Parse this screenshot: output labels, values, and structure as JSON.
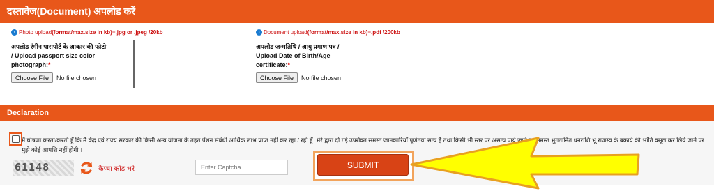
{
  "documents_section": {
    "title": "दस्तावेज(Document) अपलोड करें",
    "photo": {
      "hint_prefix": "Photo upload ",
      "hint_bold": "(format/max.size in kb)=.jpg or .jpeg /20kb",
      "label_hi": "अपलोड रंगीन पासपोर्ट के आकार की फोटो",
      "label_en": " / Upload passport size color photograph:",
      "required_mark": "*",
      "button_label": "Choose File",
      "file_status": "No file chosen"
    },
    "dob": {
      "hint_prefix": "Document upload ",
      "hint_bold": "(format/max.size in kb)=.pdf /200kb",
      "label_hi": "अपलोड जन्मतिथि / आयु प्रमाण पत्र",
      "label_en": " / Upload Date of Birth/Age certificate:",
      "required_mark": "*",
      "button_label": "Choose File",
      "file_status": "No file chosen"
    }
  },
  "declaration": {
    "title": "Declaration",
    "text": "मैं घोषणा करता/करती हूँ कि मैं केंद्र एवं राज्य सरकार की किसी अन्य योजना के तहत पेंशन संबंधी आर्थिक लाभ प्राप्त नहीं कर रहा / रही हूँ। मेरे द्वारा दी गई उपरोक्त समस्त जानकारियाँ पूर्णतया सत्य हैं तथा किसी भी स्तर पर असत्य पाये जाने पर समस्त भुगतानित धनराशि भू.राजस्व के बकाये की भांति वसूल कर लिये जाने पर मुझे कोई आपत्ति नहीं होगी ।",
    "checked": false
  },
  "captcha": {
    "code": "61148",
    "refresh_label": "कैप्चा कोड भरे",
    "input_placeholder": "Enter Captcha",
    "input_value": ""
  },
  "submit": {
    "label": "SUBMIT"
  },
  "icons": {
    "info": "info-circle-icon",
    "refresh": "refresh-icon",
    "arrow": "pointer-arrow-icon"
  },
  "colors": {
    "header": "#e8571a",
    "submit": "#d84315",
    "hint": "#cc1111",
    "arrow_fill": "#ffff00",
    "arrow_stroke": "#e8a020"
  }
}
